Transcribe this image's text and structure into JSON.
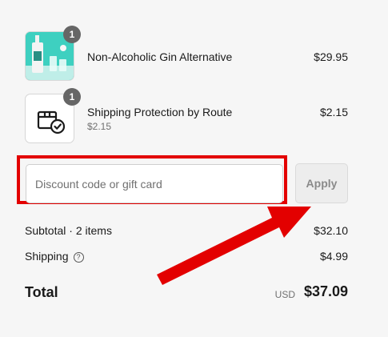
{
  "items": [
    {
      "quantity": "1",
      "name": "Non-Alcoholic Gin Alternative",
      "price": "$29.95",
      "subprice": "",
      "icon": "gin-bottle-product-image"
    },
    {
      "quantity": "1",
      "name": "Shipping Protection by Route",
      "price": "$2.15",
      "subprice": "$2.15",
      "icon": "package-check-icon"
    }
  ],
  "discount": {
    "placeholder": "Discount code or gift card",
    "apply_label": "Apply"
  },
  "summary": {
    "subtotal_label": "Subtotal · 2 items",
    "subtotal_value": "$32.10",
    "shipping_label": "Shipping",
    "shipping_help_icon": "question-circle-icon",
    "shipping_value": "$4.99",
    "total_label": "Total",
    "currency": "USD",
    "total_value": "$37.09"
  },
  "annotation": {
    "highlight_color": "#e30000",
    "arrow_color": "#e30000"
  }
}
